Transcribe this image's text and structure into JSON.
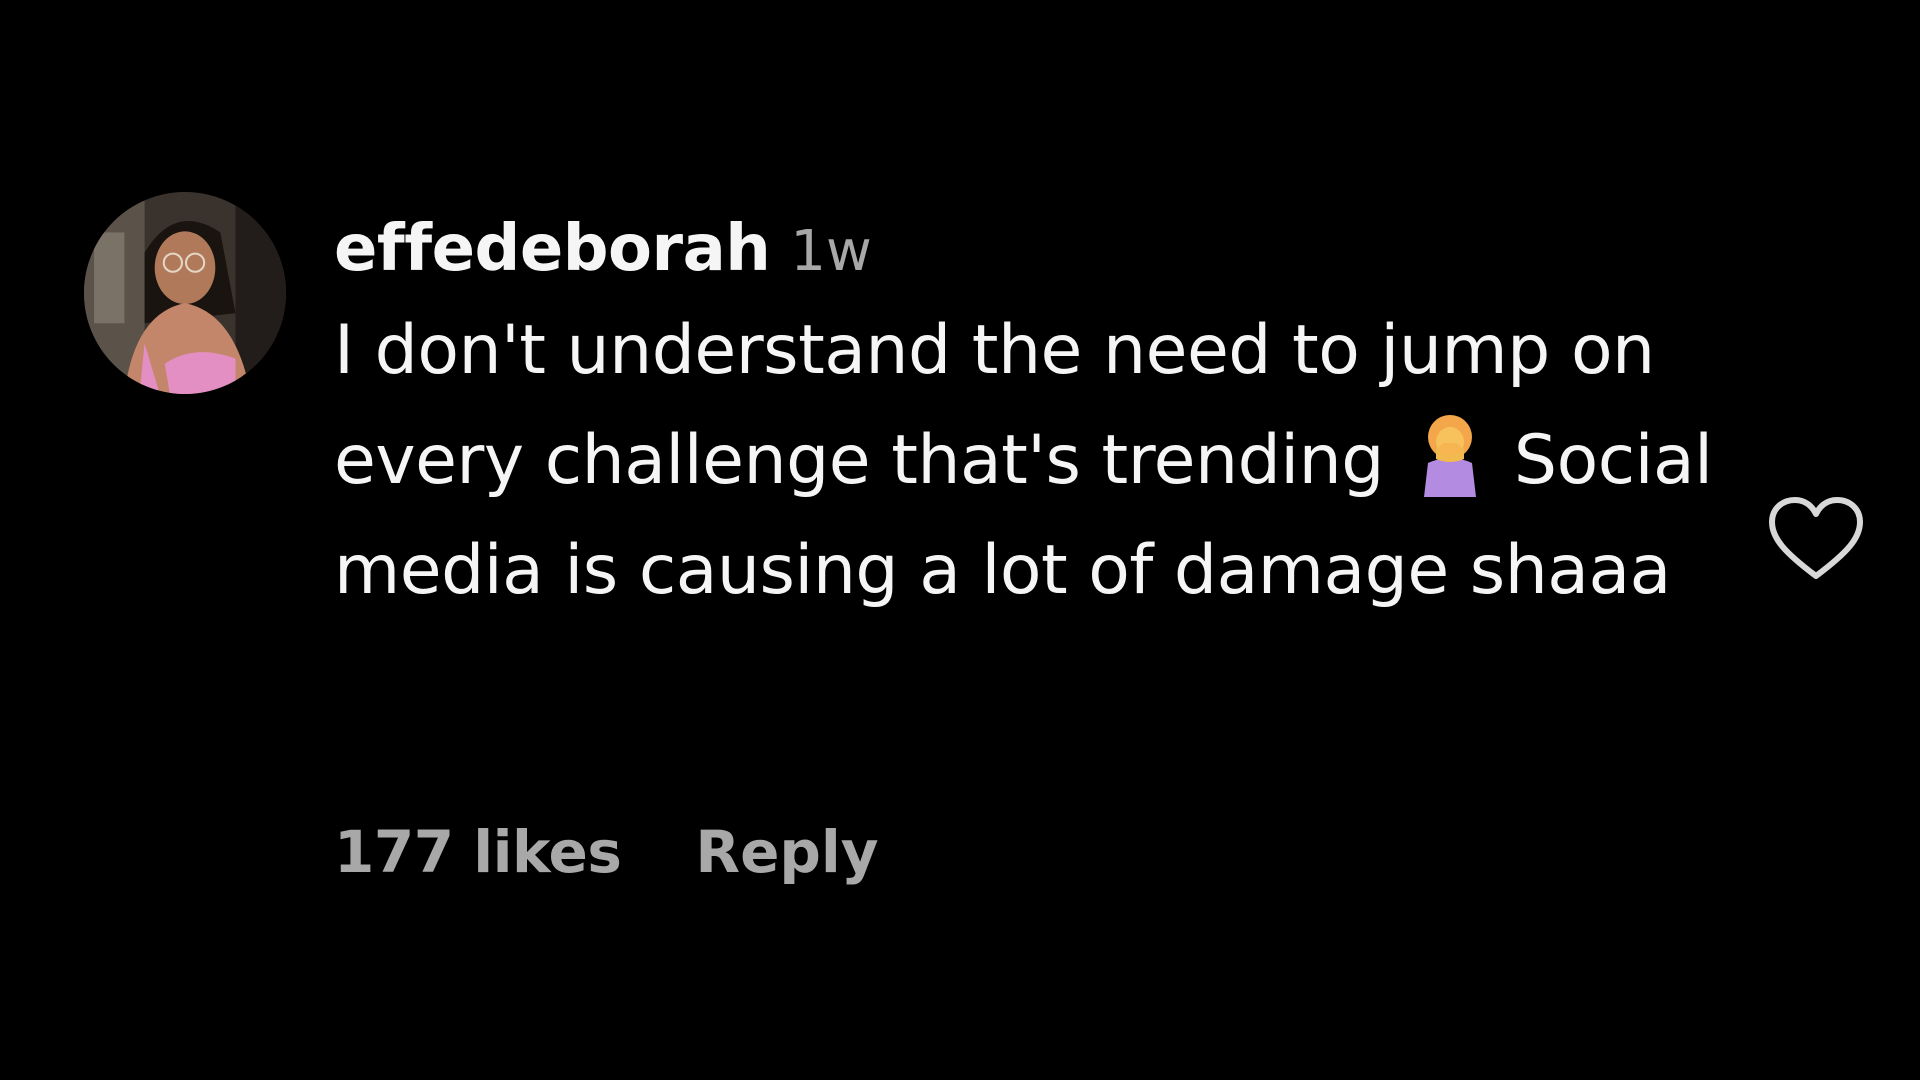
{
  "comment": {
    "username": "effedeborah",
    "timestamp": "1w",
    "text_before_emoji": "I don't understand the need to jump on every challenge that's trending",
    "emoji": "woman-facepalming-emoji",
    "text_after_emoji": "Social media is causing a lot of damage shaaa",
    "likes_label": "177 likes",
    "reply_label": "Reply",
    "like_icon": "heart-outline-icon"
  },
  "colors": {
    "background": "#000000",
    "primary_text": "#f5f5f5",
    "secondary_text": "#a8a8a8"
  }
}
